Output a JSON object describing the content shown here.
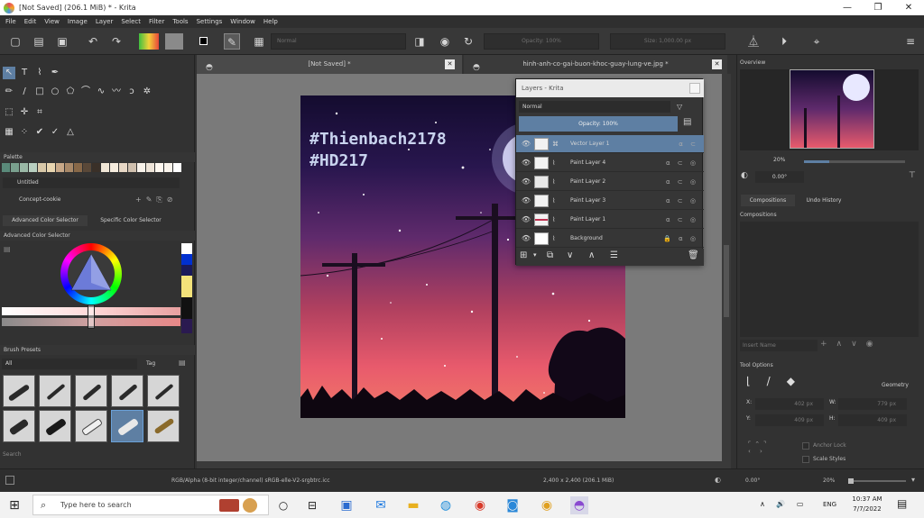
{
  "window": {
    "title": "[Not Saved]  (206.1 MiB)  * - Krita",
    "minimize": "—",
    "maximize": "❐",
    "close": "✕"
  },
  "menu": [
    "File",
    "Edit",
    "View",
    "Image",
    "Layer",
    "Select",
    "Filter",
    "Tools",
    "Settings",
    "Window",
    "Help"
  ],
  "toolbar": {
    "blend_mode": "Normal",
    "opacity": "Opacity: 100%",
    "size": "Size: 1,000.00 px"
  },
  "tabs": {
    "doc1": "[Not Saved]  *",
    "doc2": "hinh-anh-co-gai-buon-khoc-guay-lung-ve.jpg  *"
  },
  "left_panels": {
    "palette": "Palette",
    "palette_name": "Untitled",
    "brush_preset_name": "Concept-cookie",
    "tab_advanced": "Advanced Color Selector",
    "tab_specific": "Specific Color Selector",
    "color_selector": "Advanced Color Selector",
    "brush_presets": "Brush Presets",
    "brush_filter": "All",
    "tag": "Tag",
    "search": "Search"
  },
  "artwork": {
    "watermark_1": "#Thienbach2178",
    "watermark_2": "#HD217"
  },
  "layers_docker": {
    "title": "Layers - Krita",
    "blend_mode": "Normal",
    "opacity": "Opacity:  100%",
    "layers": [
      {
        "name": "Vector Layer 1",
        "selected": true
      },
      {
        "name": "Paint Layer 4",
        "selected": false
      },
      {
        "name": "Paint Layer 2",
        "selected": false
      },
      {
        "name": "Paint Layer 3",
        "selected": false
      },
      {
        "name": "Paint Layer 1",
        "selected": false
      },
      {
        "name": "Background",
        "selected": false
      }
    ]
  },
  "right_panels": {
    "overview": "Overview",
    "zoom": "20%",
    "rotation": "0.00°",
    "tab_compositions": "Compositions",
    "tab_undo": "Undo History",
    "compositions": "Compositions",
    "insert_name": "Insert Name",
    "tool_options": "Tool Options",
    "geometry": "Geometry",
    "x_label": "X:",
    "y_label": "Y:",
    "w_label": "W:",
    "h_label": "H:",
    "x_val": "402 px",
    "y_val": "409 px",
    "w_val": "779 px",
    "h_val": "409 px",
    "anchor_lock": "Anchor Lock",
    "scale_styles": "Scale Styles"
  },
  "status": {
    "colorspace": "RGB/Alpha (8-bit integer/channel)  sRGB-elle-V2-srgbtrc.icc",
    "dimensions": "2,400 x 2,400 (206.1 MiB)",
    "rotation": "0.00°",
    "zoom": "20%"
  },
  "taskbar": {
    "search_placeholder": "Type here to search",
    "lang": "ENG",
    "time": "10:37 AM",
    "date": "7/7/2022"
  }
}
